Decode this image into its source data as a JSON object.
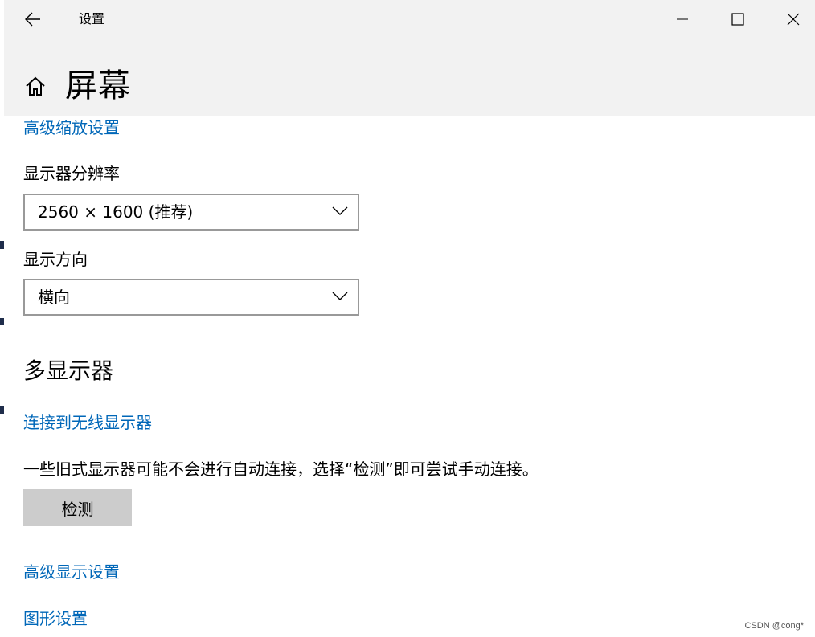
{
  "window": {
    "title": "设置",
    "back_icon": "arrow-left-icon",
    "minimize_icon": "minimize-icon",
    "maximize_icon": "maximize-icon",
    "close_icon": "close-icon"
  },
  "header": {
    "home_icon": "home-icon",
    "page_title": "屏幕"
  },
  "scale": {
    "advanced_link": "高级缩放设置"
  },
  "resolution": {
    "label": "显示器分辨率",
    "value": "2560 × 1600 (推荐)"
  },
  "orientation": {
    "label": "显示方向",
    "value": "横向"
  },
  "multi_display": {
    "title": "多显示器",
    "wireless_link": "连接到无线显示器",
    "description": "一些旧式显示器可能不会进行自动连接，选择“检测”即可尝试手动连接。",
    "detect_button": "检测"
  },
  "links": {
    "advanced_display": "高级显示设置",
    "graphics": "图形设置"
  },
  "watermark": "CSDN @cong*",
  "colors": {
    "link": "#0067b8",
    "header_bg": "#f2f2f2",
    "button_bg": "#cccccc",
    "dropdown_border": "#999999"
  }
}
